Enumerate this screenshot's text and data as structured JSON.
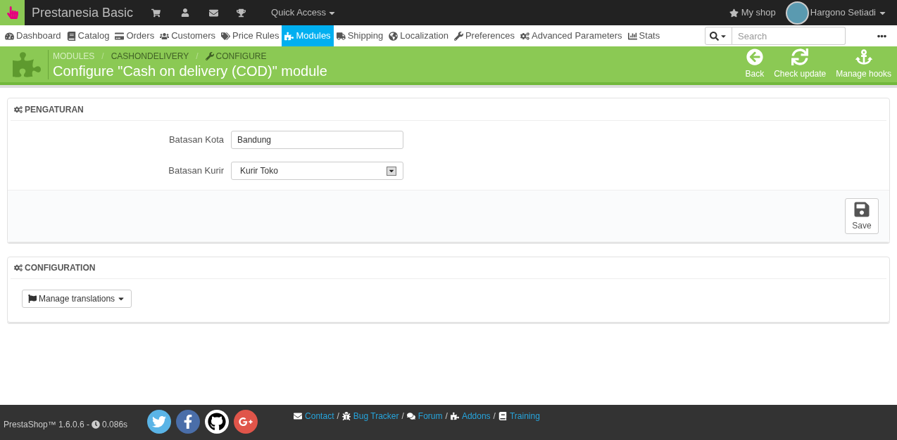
{
  "topbar": {
    "brand": "Prestanesia Basic",
    "quick_access": "Quick Access",
    "my_shop": "My shop",
    "user": "Hargono Setiadi"
  },
  "nav": [
    {
      "kind": "dashboard",
      "label": "Dashboard",
      "selected": false
    },
    {
      "kind": "catalog",
      "label": "Catalog",
      "selected": false
    },
    {
      "kind": "orders",
      "label": "Orders",
      "selected": false
    },
    {
      "kind": "customers",
      "label": "Customers",
      "selected": false
    },
    {
      "kind": "price",
      "label": "Price Rules",
      "selected": false
    },
    {
      "kind": "modules",
      "label": "Modules",
      "selected": true
    },
    {
      "kind": "shipping",
      "label": "Shipping",
      "selected": false
    },
    {
      "kind": "localization",
      "label": "Localization",
      "selected": false
    },
    {
      "kind": "preferences",
      "label": "Preferences",
      "selected": false
    },
    {
      "kind": "advanced",
      "label": "Advanced Parameters",
      "selected": false
    },
    {
      "kind": "stats",
      "label": "Stats",
      "selected": false
    }
  ],
  "search": {
    "placeholder": "Search"
  },
  "header": {
    "breadcrumb": [
      {
        "label": "MODULES",
        "separator": "/"
      },
      {
        "label": "CASHONDELIVERY",
        "separator": "/"
      },
      {
        "label": "CONFIGURE"
      }
    ],
    "title": "Configure \"Cash on delivery (COD)\" module",
    "toolbar": [
      {
        "kind": "back",
        "label": "Back"
      },
      {
        "kind": "update",
        "label": "Check update"
      },
      {
        "kind": "hooks",
        "label": "Manage hooks"
      }
    ]
  },
  "settings_panel": {
    "title": "PENGATURAN",
    "fields": [
      {
        "kind": "text",
        "label": "Batasan Kota",
        "value": "Bandung"
      },
      {
        "kind": "select",
        "label": "Batasan Kurir",
        "value": "Kurir Toko"
      }
    ],
    "save": "Save"
  },
  "config_panel": {
    "title": "CONFIGURATION",
    "button": "Manage translations"
  },
  "footer": {
    "version": "PrestaShop™ 1.6.0.6 -",
    "time": "0.086s",
    "links": [
      {
        "kind": "contact",
        "label": "Contact",
        "separator": "/"
      },
      {
        "kind": "bug",
        "label": "Bug Tracker",
        "separator": "/"
      },
      {
        "kind": "forum",
        "label": "Forum",
        "separator": "/"
      },
      {
        "kind": "addons",
        "label": "Addons",
        "separator": "/"
      },
      {
        "kind": "training",
        "label": "Training"
      }
    ]
  }
}
